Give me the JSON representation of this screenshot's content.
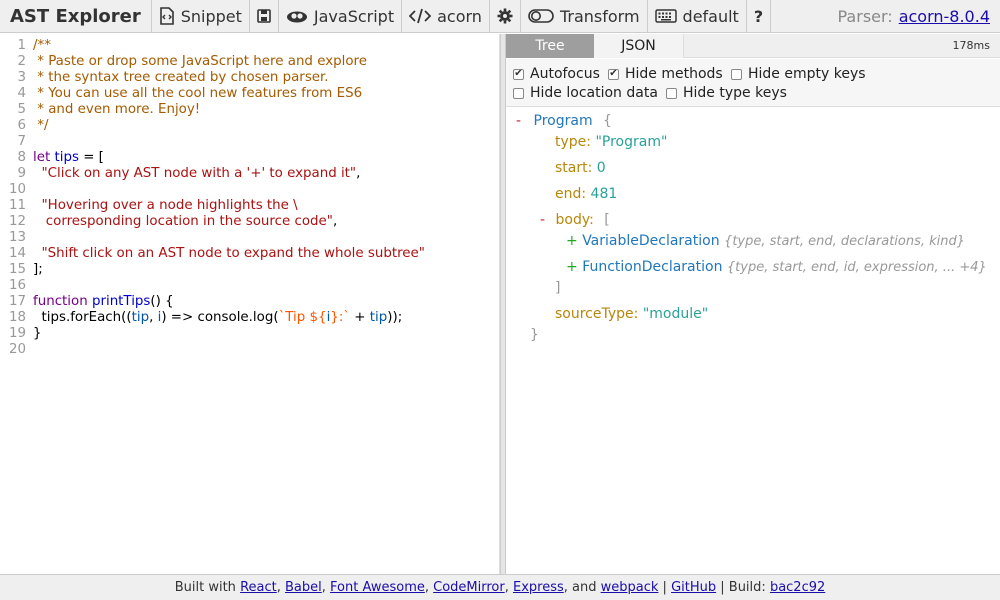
{
  "toolbar": {
    "brand": "AST Explorer",
    "snippet": "Snippet",
    "language": "JavaScript",
    "parser_name": "acorn",
    "transform": "Transform",
    "keymap": "default",
    "help": "?",
    "parser_label": "Parser:",
    "parser_version": "acorn-8.0.4"
  },
  "editor": {
    "lines": [
      {
        "n": "1",
        "parts": [
          {
            "t": "/**",
            "c": "c-comment"
          }
        ]
      },
      {
        "n": "2",
        "parts": [
          {
            "t": " * Paste or drop some JavaScript here and explore",
            "c": "c-comment"
          }
        ]
      },
      {
        "n": "3",
        "parts": [
          {
            "t": " * the syntax tree created by chosen parser.",
            "c": "c-comment"
          }
        ]
      },
      {
        "n": "4",
        "parts": [
          {
            "t": " * You can use all the cool new features from ES6",
            "c": "c-comment"
          }
        ]
      },
      {
        "n": "5",
        "parts": [
          {
            "t": " * and even more. Enjoy!",
            "c": "c-comment"
          }
        ]
      },
      {
        "n": "6",
        "parts": [
          {
            "t": " */",
            "c": "c-comment"
          }
        ]
      },
      {
        "n": "7",
        "parts": []
      },
      {
        "n": "8",
        "parts": [
          {
            "t": "let",
            "c": "c-kw"
          },
          {
            "t": " ",
            "c": "c-plain"
          },
          {
            "t": "tips",
            "c": "c-def"
          },
          {
            "t": " = [",
            "c": "c-plain"
          }
        ]
      },
      {
        "n": "9",
        "parts": [
          {
            "t": "  ",
            "c": "c-plain"
          },
          {
            "t": "\"Click on any AST node with a '+' to expand it\"",
            "c": "c-str"
          },
          {
            "t": ",",
            "c": "c-plain"
          }
        ]
      },
      {
        "n": "10",
        "parts": []
      },
      {
        "n": "11",
        "parts": [
          {
            "t": "  ",
            "c": "c-plain"
          },
          {
            "t": "\"Hovering over a node highlights the \\",
            "c": "c-str"
          }
        ]
      },
      {
        "n": "12",
        "parts": [
          {
            "t": "   corresponding location in the source code\"",
            "c": "c-str"
          },
          {
            "t": ",",
            "c": "c-plain"
          }
        ]
      },
      {
        "n": "13",
        "parts": []
      },
      {
        "n": "14",
        "parts": [
          {
            "t": "  ",
            "c": "c-plain"
          },
          {
            "t": "\"Shift click on an AST node to expand the whole subtree\"",
            "c": "c-str"
          }
        ]
      },
      {
        "n": "15",
        "parts": [
          {
            "t": "];",
            "c": "c-plain"
          }
        ]
      },
      {
        "n": "16",
        "parts": []
      },
      {
        "n": "17",
        "parts": [
          {
            "t": "function",
            "c": "c-kw"
          },
          {
            "t": " ",
            "c": "c-plain"
          },
          {
            "t": "printTips",
            "c": "c-def"
          },
          {
            "t": "() {",
            "c": "c-plain"
          }
        ]
      },
      {
        "n": "18",
        "parts": [
          {
            "t": "  tips.forEach((",
            "c": "c-plain"
          },
          {
            "t": "tip",
            "c": "c-var"
          },
          {
            "t": ", ",
            "c": "c-plain"
          },
          {
            "t": "i",
            "c": "c-var"
          },
          {
            "t": ") => console.log(",
            "c": "c-plain"
          },
          {
            "t": "`Tip ${",
            "c": "c-tmpl"
          },
          {
            "t": "i",
            "c": "c-var"
          },
          {
            "t": "}:`",
            "c": "c-tmpl"
          },
          {
            "t": " + ",
            "c": "c-plain"
          },
          {
            "t": "tip",
            "c": "c-var"
          },
          {
            "t": "));",
            "c": "c-plain"
          }
        ]
      },
      {
        "n": "19",
        "parts": [
          {
            "t": "}",
            "c": "c-plain"
          }
        ]
      },
      {
        "n": "20",
        "parts": []
      }
    ]
  },
  "panel": {
    "tab_tree": "Tree",
    "tab_json": "JSON",
    "timing": "178ms",
    "options": {
      "autofocus": "Autofocus",
      "hide_methods": "Hide methods",
      "hide_empty_keys": "Hide empty keys",
      "hide_location_data": "Hide location data",
      "hide_type_keys": "Hide type keys",
      "autofocus_checked": true,
      "hide_methods_checked": true,
      "hide_empty_keys_checked": false,
      "hide_location_data_checked": false,
      "hide_type_keys_checked": false
    },
    "tree": {
      "minus": "-",
      "plus": "+",
      "program": "Program",
      "open_brace": "{",
      "close_brace": "}",
      "type_key": "type:",
      "type_val": "\"Program\"",
      "start_key": "start:",
      "start_val": "0",
      "end_key": "end:",
      "end_val": "481",
      "body_key": "body:",
      "open_bracket": "[",
      "close_bracket": "]",
      "var_decl": "VariableDeclaration",
      "var_decl_summary": "{type, start, end, declarations, kind}",
      "func_decl": "FunctionDeclaration",
      "func_decl_summary": "{type, start, end, id, expression, ... +4}",
      "source_type_key": "sourceType:",
      "source_type_val": "\"module\""
    }
  },
  "footer": {
    "built_with": "Built with",
    "react": "React",
    "babel": "Babel",
    "font_awesome": "Font Awesome",
    "codemirror": "CodeMirror",
    "express": "Express",
    "and": ", and",
    "webpack": "webpack",
    "github": "GitHub",
    "build_label": "| Build:",
    "build_hash": "bac2c92"
  }
}
